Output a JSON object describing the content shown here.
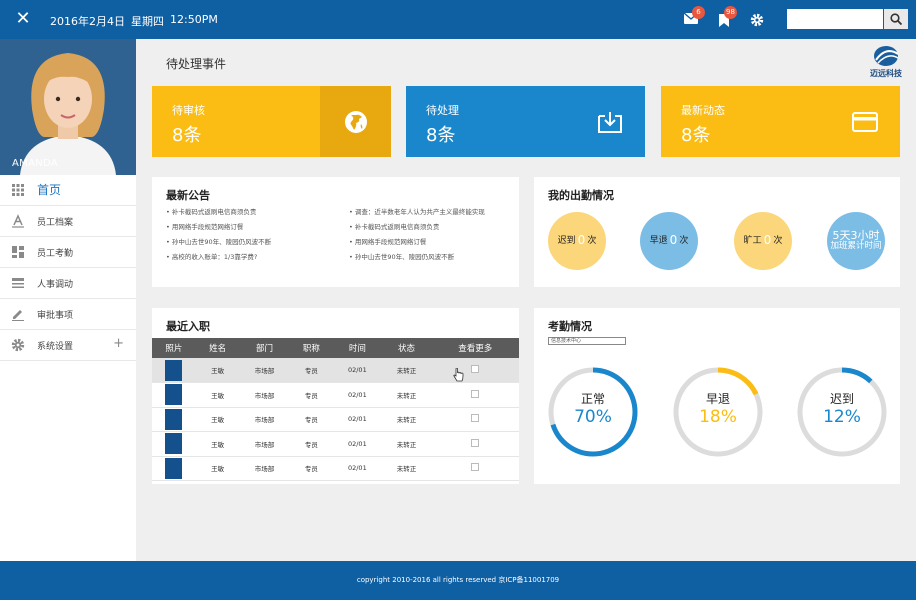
{
  "topbar": {
    "date": "2016年2月4日",
    "weekday": "星期四",
    "time": "12:50PM",
    "mail_badge": "6",
    "bookmark_badge": "98",
    "search_placeholder": "",
    "accent": "#0f5fa3"
  },
  "user": {
    "name": "AMANDA"
  },
  "sidebar": {
    "items": [
      {
        "label": "首页",
        "icon": "grid-icon"
      },
      {
        "label": "员工档案",
        "icon": "font-icon"
      },
      {
        "label": "员工考勤",
        "icon": "dashboard-icon"
      },
      {
        "label": "人事调动",
        "icon": "list-icon"
      },
      {
        "label": "审批事项",
        "icon": "pencil-icon"
      },
      {
        "label": "系统设置",
        "icon": "gear-icon",
        "expand": "+"
      }
    ]
  },
  "main": {
    "title": "待处理事件",
    "logo_text": "迈远科技",
    "cards": [
      {
        "label": "待审核",
        "value": "8条",
        "color": "#fbbd13",
        "icon": "globe-icon"
      },
      {
        "label": "待处理",
        "value": "8条",
        "color": "#1a87cd",
        "icon": "download-icon"
      },
      {
        "label": "最新动态",
        "value": "8条",
        "color": "#fbbd13",
        "icon": "card-icon"
      }
    ]
  },
  "news": {
    "title": "最新公告",
    "left": [
      "• 补卡截码式返刷电信商须负责",
      "• 用网络手段规范网络订餐",
      "• 孙中山去世90年、陵园仍风波不断",
      "• 高校的收入账单：1/3靠学费?"
    ],
    "right": [
      "• 调查：近半数老年人认为共产主义最终能实现",
      "• 补卡截码式返刷电信商须负责",
      "• 用网络手段规范网络订餐",
      "• 孙中山去世90年、陵园仍风波不断"
    ]
  },
  "attendance": {
    "title": "我的出勤情况",
    "items": [
      {
        "pre": "迟到",
        "num": "0",
        "post": "次",
        "color": "#fbd67a"
      },
      {
        "pre": "早退",
        "num": "0",
        "post": "次",
        "color": "#7cbde6"
      },
      {
        "pre": "旷工",
        "num": "0",
        "post": "次",
        "color": "#fbd67a"
      }
    ],
    "overtime_top": "5天3小时",
    "overtime_bottom": "加班累计时间"
  },
  "recent": {
    "title": "最近入职",
    "headers": [
      "照片",
      "姓名",
      "部门",
      "职称",
      "时间",
      "状态",
      "查看更多"
    ],
    "rows": [
      [
        "王敏",
        "市场部",
        "专员",
        "02/01",
        "未转正"
      ],
      [
        "王敏",
        "市场部",
        "专员",
        "02/01",
        "未转正"
      ],
      [
        "王敏",
        "市场部",
        "专员",
        "02/01",
        "未转正"
      ],
      [
        "王敏",
        "市场部",
        "专员",
        "02/01",
        "未转正"
      ],
      [
        "王敏",
        "市场部",
        "专员",
        "02/01",
        "未转正"
      ]
    ]
  },
  "kaoqin": {
    "title": "考勤情况",
    "select": "信息技术中心",
    "rings": [
      {
        "label": "正常",
        "value": "70%",
        "fraction": 0.7,
        "color": "#1a87cd"
      },
      {
        "label": "早退",
        "value": "18%",
        "fraction": 0.18,
        "color": "#fbbd13"
      },
      {
        "label": "迟到",
        "value": "12%",
        "fraction": 0.12,
        "color": "#1a87cd"
      }
    ]
  },
  "footer": {
    "text": "copyright 2010-2016  all rights reserved 京ICP备11001709"
  }
}
